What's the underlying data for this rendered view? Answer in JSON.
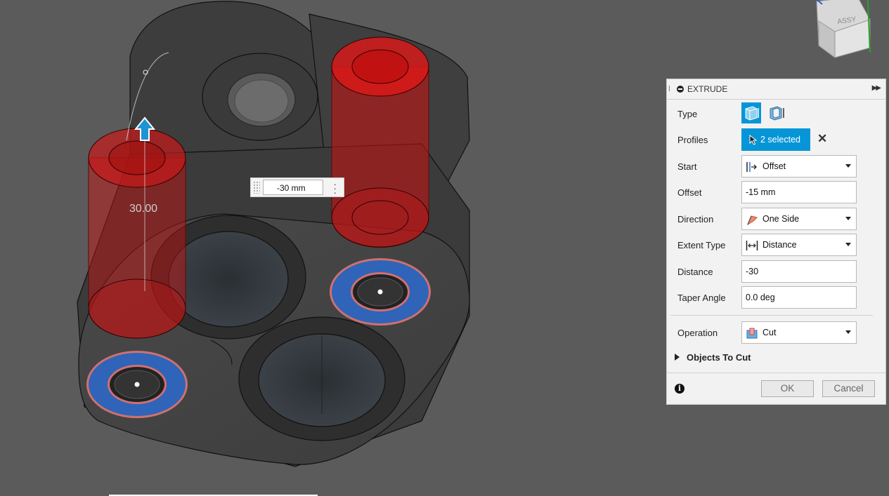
{
  "canvas": {
    "dimension_label": "30.00",
    "viewcube_label": "ASSY"
  },
  "distance_input": {
    "value": "-30 mm"
  },
  "extrude_dialog": {
    "title": "EXTRUDE",
    "expand_icon": "double-chevron-right-icon",
    "type": {
      "label": "Type",
      "options": [
        "solid-extrude-icon",
        "thin-extrude-icon"
      ],
      "selected": 0
    },
    "profiles": {
      "label": "Profiles",
      "value": "2 selected",
      "icon": "cursor-arrow-icon",
      "clear_icon": "close-icon"
    },
    "start": {
      "label": "Start",
      "value": "Offset",
      "icon": "offset-start-icon"
    },
    "offset": {
      "label": "Offset",
      "value": "-15 mm"
    },
    "direction": {
      "label": "Direction",
      "value": "One Side",
      "icon": "one-side-flag-icon"
    },
    "extent_type": {
      "label": "Extent Type",
      "value": "Distance",
      "icon": "distance-arrows-icon"
    },
    "distance": {
      "label": "Distance",
      "value": "-30"
    },
    "taper_angle": {
      "label": "Taper Angle",
      "value": "0.0 deg"
    },
    "operation": {
      "label": "Operation",
      "value": "Cut",
      "icon": "cut-operation-icon"
    },
    "objects_to_cut": {
      "label": "Objects To Cut",
      "expanded": false
    },
    "ok_label": "OK",
    "cancel_label": "Cancel"
  },
  "colors": {
    "viewport_bg": "#5b5b5b",
    "selection_blue": "#0696d7",
    "extrude_red": "#d01010",
    "profile_blue": "#2f64b8"
  }
}
